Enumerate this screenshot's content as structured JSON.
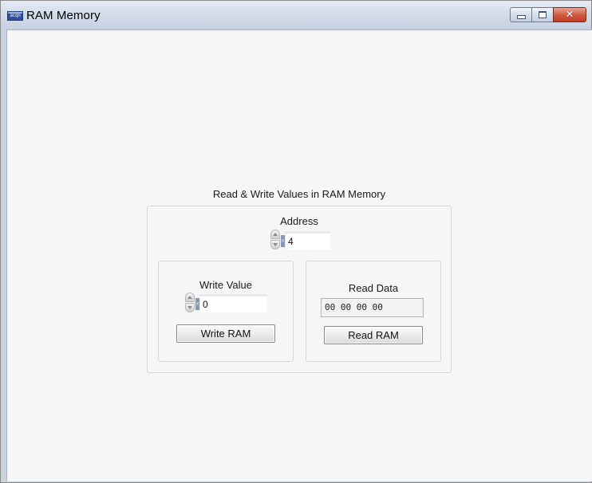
{
  "window": {
    "title": "RAM Memory",
    "icon_text": "acqn",
    "icon": "labview-app-icon",
    "controls": {
      "minimize_icon": "minimize-icon",
      "maximize_icon": "maximize-icon",
      "close_icon": "close-icon",
      "close_glyph": "✕"
    }
  },
  "panel": {
    "title": "Read & Write Values in RAM Memory",
    "address": {
      "label": "Address",
      "value": "4",
      "radix_glyph": "x"
    },
    "write": {
      "label": "Write Value",
      "value": "0",
      "radix_glyph": "x",
      "button_label": "Write RAM"
    },
    "read": {
      "label": "Read Data",
      "value": "00 00 00 00",
      "button_label": "Read RAM"
    }
  },
  "colors": {
    "client_bg": "#f6f6f6",
    "titlebar": "#d3dcea",
    "close_button": "#c94a30"
  }
}
